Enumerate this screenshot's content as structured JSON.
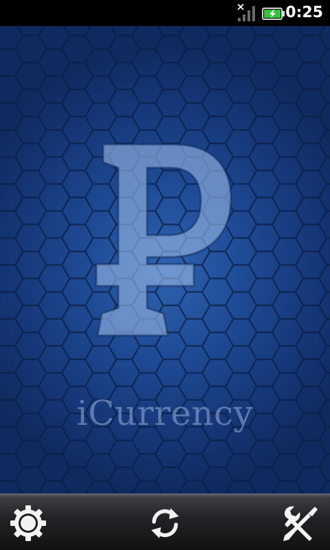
{
  "status_bar": {
    "time": "0:25",
    "signal_icon": "signal-no-service-icon",
    "battery_icon": "battery-charging-icon",
    "battery_color": "#36c23a"
  },
  "main": {
    "logo_symbol": "₽",
    "logo_icon": "ruble-logo-icon",
    "app_name": "iCurrency",
    "background_color": "#1e4a94"
  },
  "toolbar": {
    "buttons": [
      {
        "icon": "gear-icon",
        "action": "settings"
      },
      {
        "icon": "refresh-icon",
        "action": "refresh"
      },
      {
        "icon": "tools-icon",
        "action": "tools"
      }
    ]
  }
}
